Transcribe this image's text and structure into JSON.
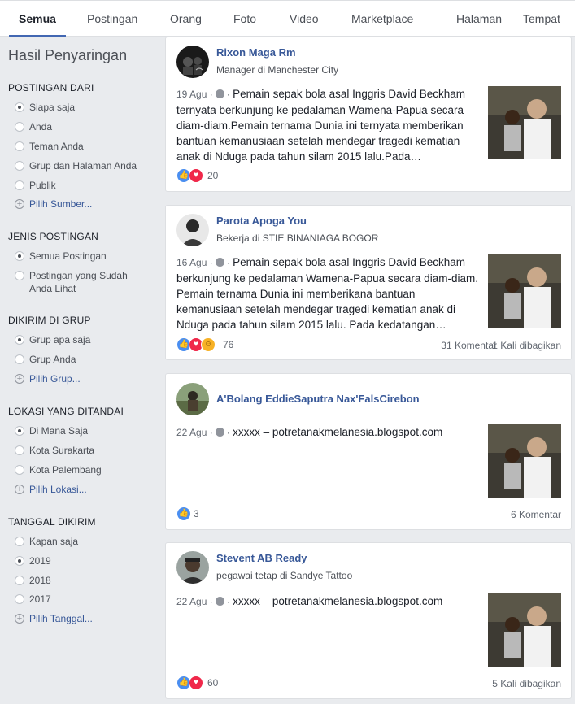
{
  "tabs": [
    {
      "label": "Semua"
    },
    {
      "label": "Postingan"
    },
    {
      "label": "Orang"
    },
    {
      "label": "Foto"
    },
    {
      "label": "Video"
    },
    {
      "label": "Marketplace"
    },
    {
      "label": "Halaman"
    },
    {
      "label": "Tempat"
    }
  ],
  "sidebar": {
    "title": "Hasil Penyaringan",
    "sections": [
      {
        "heading": "POSTINGAN DARI",
        "options": [
          "Siapa saja",
          "Anda",
          "Teman Anda",
          "Grup dan Halaman Anda",
          "Publik"
        ],
        "selected": "Siapa saja",
        "more": "Pilih Sumber..."
      },
      {
        "heading": "JENIS POSTINGAN",
        "options": [
          "Semua Postingan",
          "Postingan yang Sudah Anda Lihat"
        ],
        "selected": "Semua Postingan"
      },
      {
        "heading": "DIKIRIM DI GRUP",
        "options": [
          "Grup apa saja",
          "Grup Anda"
        ],
        "selected": "Grup apa saja",
        "more": "Pilih Grup..."
      },
      {
        "heading": "LOKASI YANG DITANDAI",
        "options": [
          "Di Mana Saja",
          "Kota Surakarta",
          "Kota Palembang"
        ],
        "selected": "Di Mana Saja",
        "more": "Pilih Lokasi..."
      },
      {
        "heading": "TANGGAL DIKIRIM",
        "options": [
          "Kapan saja",
          "2019",
          "2018",
          "2017"
        ],
        "selected": "2019",
        "more": "Pilih Tanggal..."
      }
    ]
  },
  "posts": [
    {
      "author": "Rixon Maga Rm",
      "subtitle": "Manager di Manchester City",
      "date": "19 Agu",
      "text": "Pemain sepak bola asal Inggris David Beckham ternyata berkunjung ke pedalaman Wamena-Papua secara diam-diam.Pemain ternama Dunia ini ternyata memberikan bantuan kemanusiaan setelah mendegar tragedi kematian anak di Nduga pada tahun silam 2015 lalu.Pada…",
      "reaction_count": "20",
      "comments": "",
      "shares": ""
    },
    {
      "author": "Parota Apoga You",
      "subtitle": "Bekerja di STIE BINANIAGA BOGOR",
      "date": "16 Agu",
      "text": "Pemain sepak bola asal Inggris David Beckham berkunjung ke pedalaman Wamena-Papua secara diam-diam. Pemain ternama Dunia ini memberikana bantuan kemanusiaan setelah mendegar tragedi kematian anak di Nduga pada tahun silam 2015 lalu. Pada kedatangan…",
      "reaction_count": "76",
      "comments": "31 Komentar",
      "shares": "1 Kali dibagikan"
    },
    {
      "author": "A'Bolang EddieSaputra Nax'FalsCirebon",
      "subtitle": "",
      "date": "22 Agu",
      "text": "xxxxx – potretanakmelanesia.blogspot.com",
      "reaction_count": "3",
      "comments": "6 Komentar",
      "shares": ""
    },
    {
      "author": "Stevent AB Ready",
      "subtitle": "pegawai tetap di Sandye Tattoo",
      "date": "22 Agu",
      "text": "xxxxx – potretanakmelanesia.blogspot.com",
      "reaction_count": "60",
      "comments": "",
      "shares": "5 Kali dibagikan"
    }
  ],
  "colors": {
    "link": "#385898",
    "accent": "#4267b2",
    "background": "#e9ebee",
    "like": "#4a8ef0",
    "love": "#f0284a",
    "haha": "#f7b125"
  }
}
